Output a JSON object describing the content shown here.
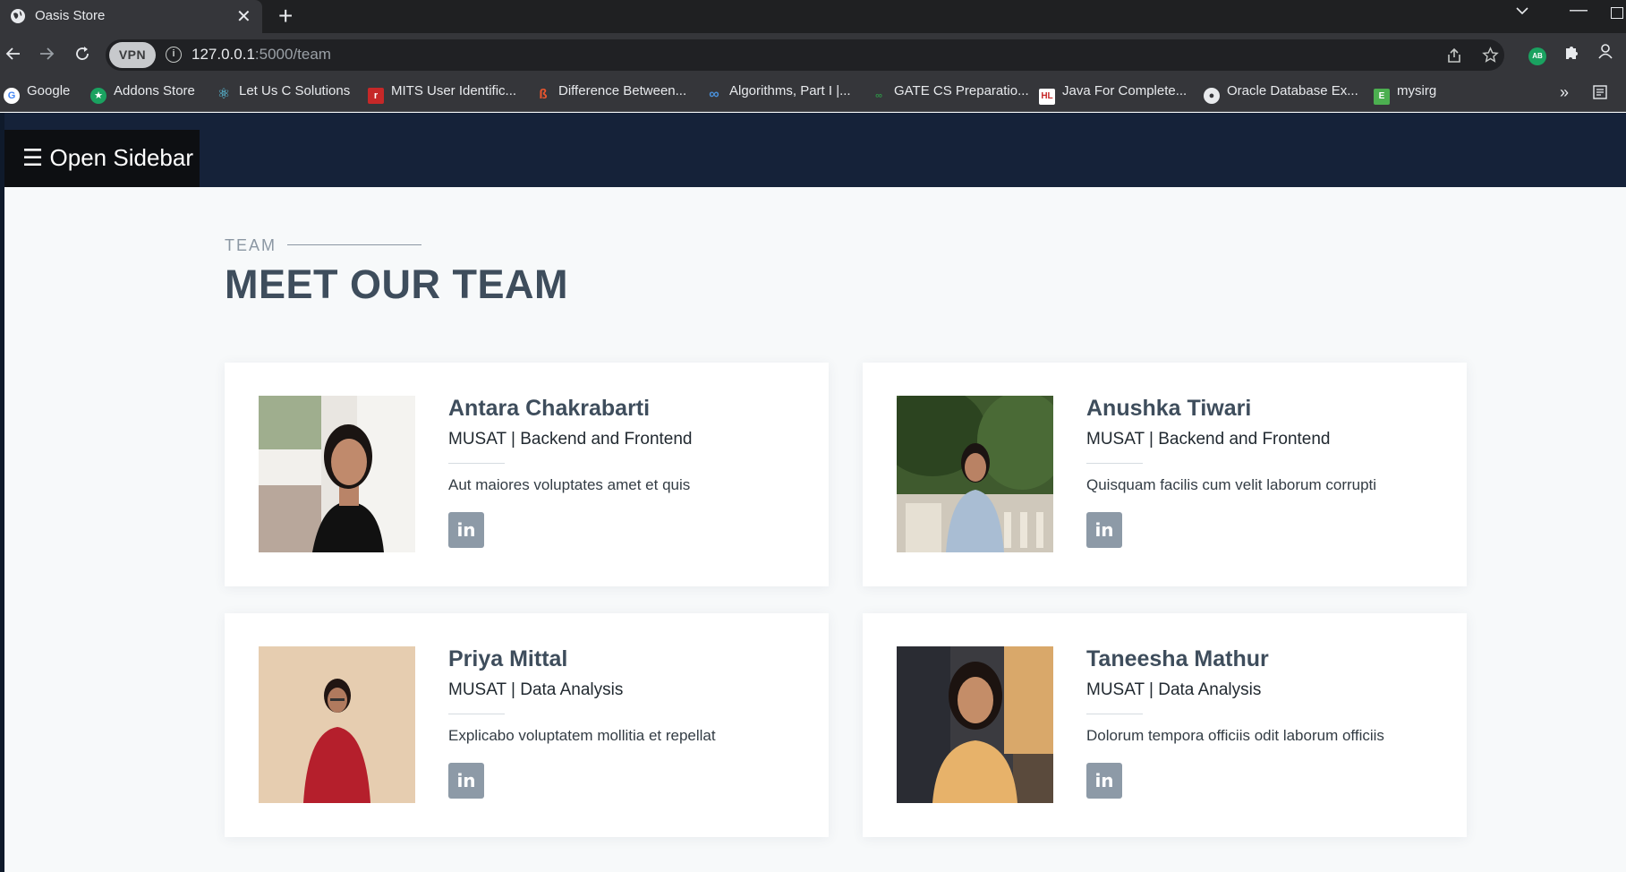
{
  "browser": {
    "tab_title": "Oasis Store",
    "tab_close": "✕",
    "new_tab": "+",
    "url_host": "127.0.0.1",
    "url_path": ":5000/team",
    "vpn_label": "VPN",
    "bookmarks": [
      {
        "label": "Google",
        "icon": "google-icon",
        "color": "#ffffff"
      },
      {
        "label": "Addons Store",
        "icon": "addons-store-icon",
        "color": "#1aa260"
      },
      {
        "label": "Let Us C Solutions",
        "icon": "react-icon",
        "color": "#61dafb"
      },
      {
        "label": "MITS User Identific...",
        "icon": "mits-icon",
        "color": "#c62828"
      },
      {
        "label": "Difference Between...",
        "icon": "difference-icon",
        "color": "#e8552e"
      },
      {
        "label": "Algorithms, Part I |...",
        "icon": "infinity-icon",
        "color": "#4a90d9"
      },
      {
        "label": "GATE CS Preparatio...",
        "icon": "gfg-icon",
        "color": "#2f8d46"
      },
      {
        "label": "Java For Complete...",
        "icon": "hl-icon",
        "color": "#ffffff"
      },
      {
        "label": "Oracle Database Ex...",
        "icon": "globe-icon",
        "color": "#ffffff"
      },
      {
        "label": "mysirg",
        "icon": "mysirg-icon",
        "color": "#4caf50"
      }
    ],
    "bookmarks_more": "»"
  },
  "nav": {
    "sidebar_button": "☰ Open Sidebar"
  },
  "section": {
    "label": "TEAM",
    "title": "MEET OUR TEAM"
  },
  "team": [
    {
      "name": "Antara Chakrabarti",
      "role": "MUSAT | Backend and Frontend",
      "desc": "Aut maiores voluptates amet et quis",
      "social": "in"
    },
    {
      "name": "Anushka Tiwari",
      "role": "MUSAT | Backend and Frontend",
      "desc": "Quisquam facilis cum velit laborum corrupti",
      "social": "in"
    },
    {
      "name": "Priya Mittal",
      "role": "MUSAT | Data Analysis",
      "desc": "Explicabo voluptatem mollitia et repellat",
      "social": "in"
    },
    {
      "name": "Taneesha Mathur",
      "role": "MUSAT | Data Analysis",
      "desc": "Dolorum tempora officiis odit laborum officiis",
      "social": "in"
    }
  ],
  "colors": {
    "nav_bg": "#152239",
    "heading": "#3e4d5c",
    "linkedin_button": "#8d9aa7"
  }
}
